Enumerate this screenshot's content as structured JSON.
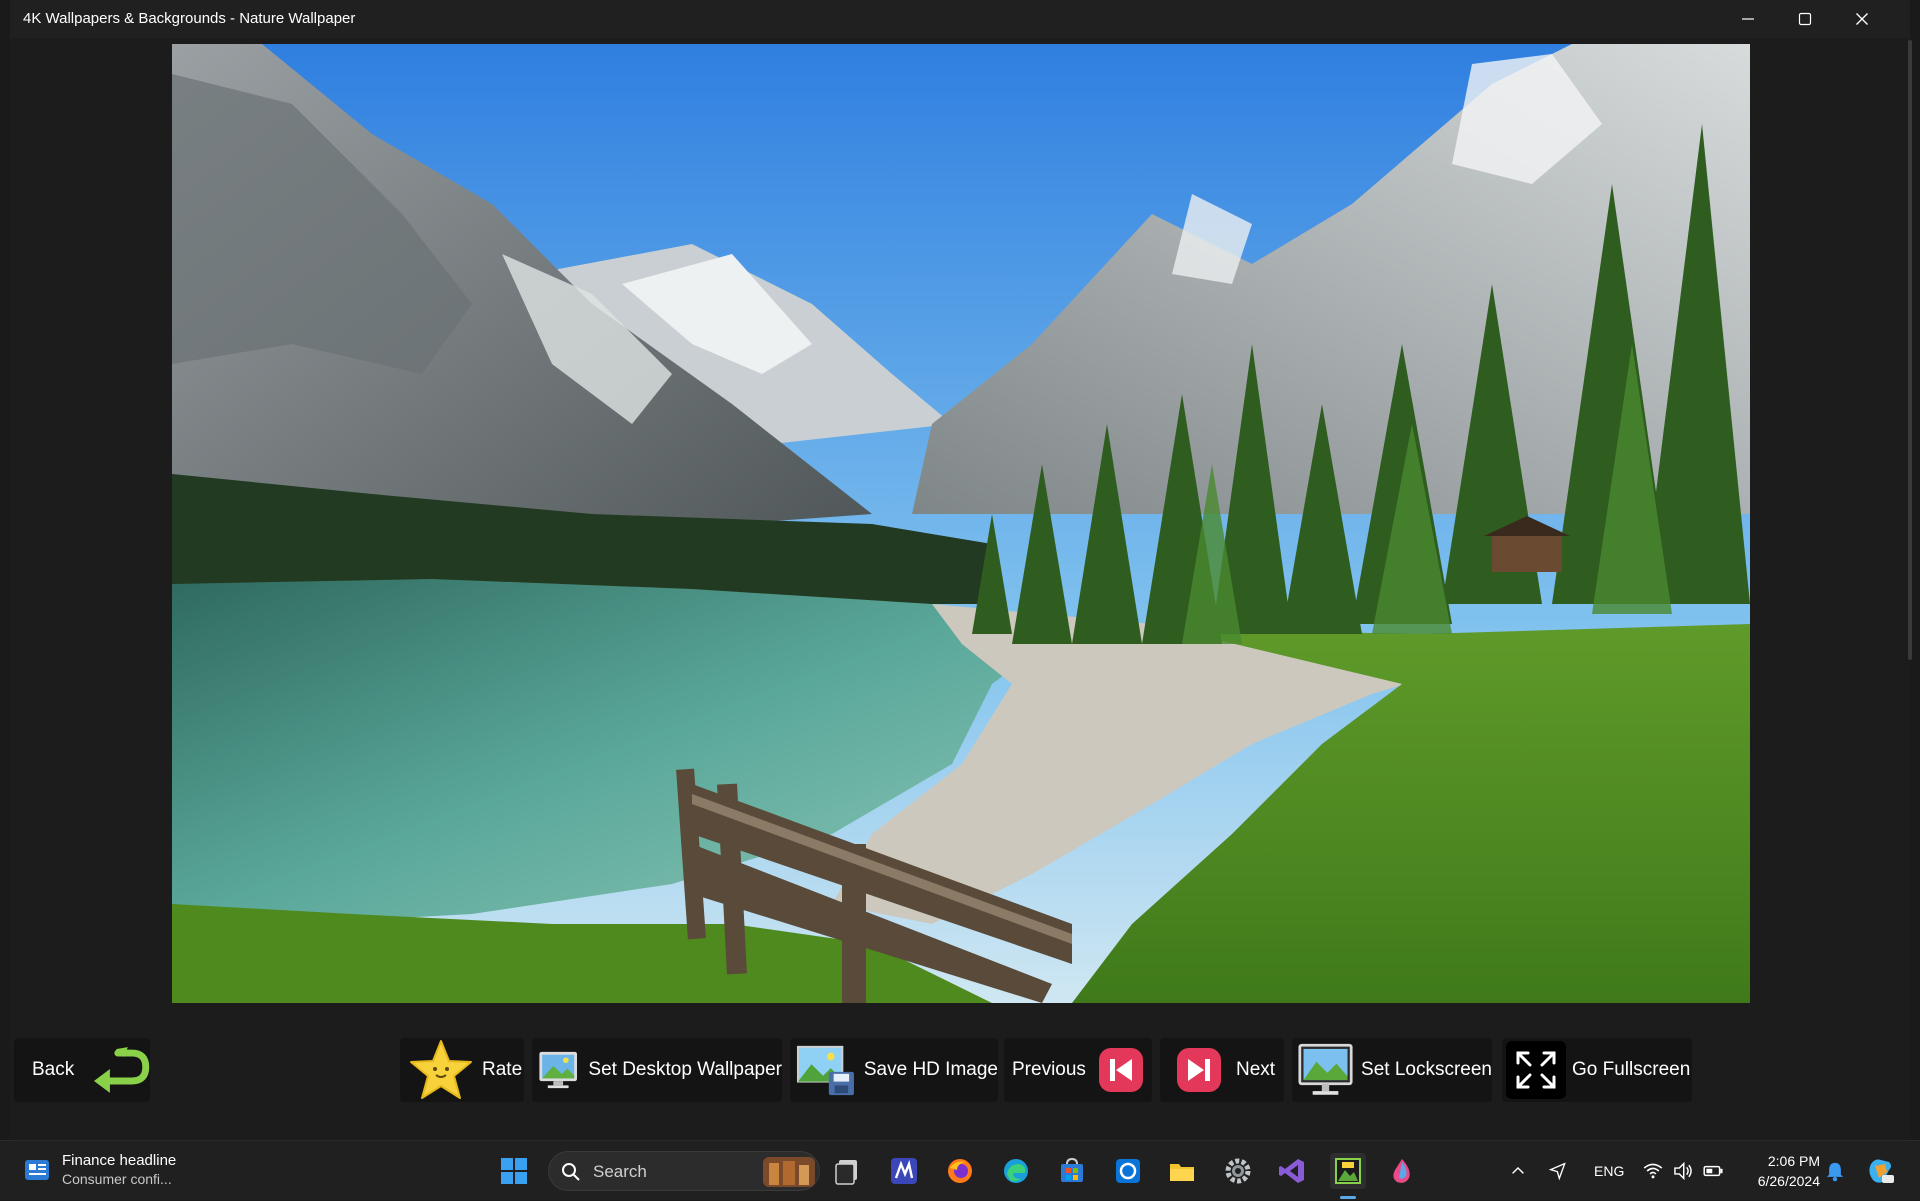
{
  "window": {
    "title": "4K Wallpapers & Backgrounds - Nature Wallpaper"
  },
  "actions": {
    "back": "Back",
    "rate": "Rate",
    "set_desktop": "Set Desktop Wallpaper",
    "save_hd": "Save HD Image",
    "previous": "Previous",
    "next": "Next",
    "set_lockscreen": "Set Lockscreen",
    "fullscreen": "Go Fullscreen"
  },
  "taskbar": {
    "news_headline": "Finance headline",
    "news_sub": "Consumer confi...",
    "search_placeholder": "Search",
    "language": "ENG",
    "time": "2:06 PM",
    "date": "6/26/2024",
    "pinned_icons": [
      "windows-start-icon",
      "search-icon",
      "task-view-icon",
      "editor-icon",
      "firefox-icon",
      "edge-icon",
      "store-icon",
      "cortana-icon",
      "file-explorer-icon",
      "settings-icon",
      "visual-studio-icon",
      "wallpapers-app-icon",
      "paint-icon"
    ]
  },
  "colors": {
    "accent_green": "#8ad14a",
    "action_red": "#e4385a",
    "star_yellow": "#f7d23a",
    "titlebar_bg": "#202020"
  }
}
